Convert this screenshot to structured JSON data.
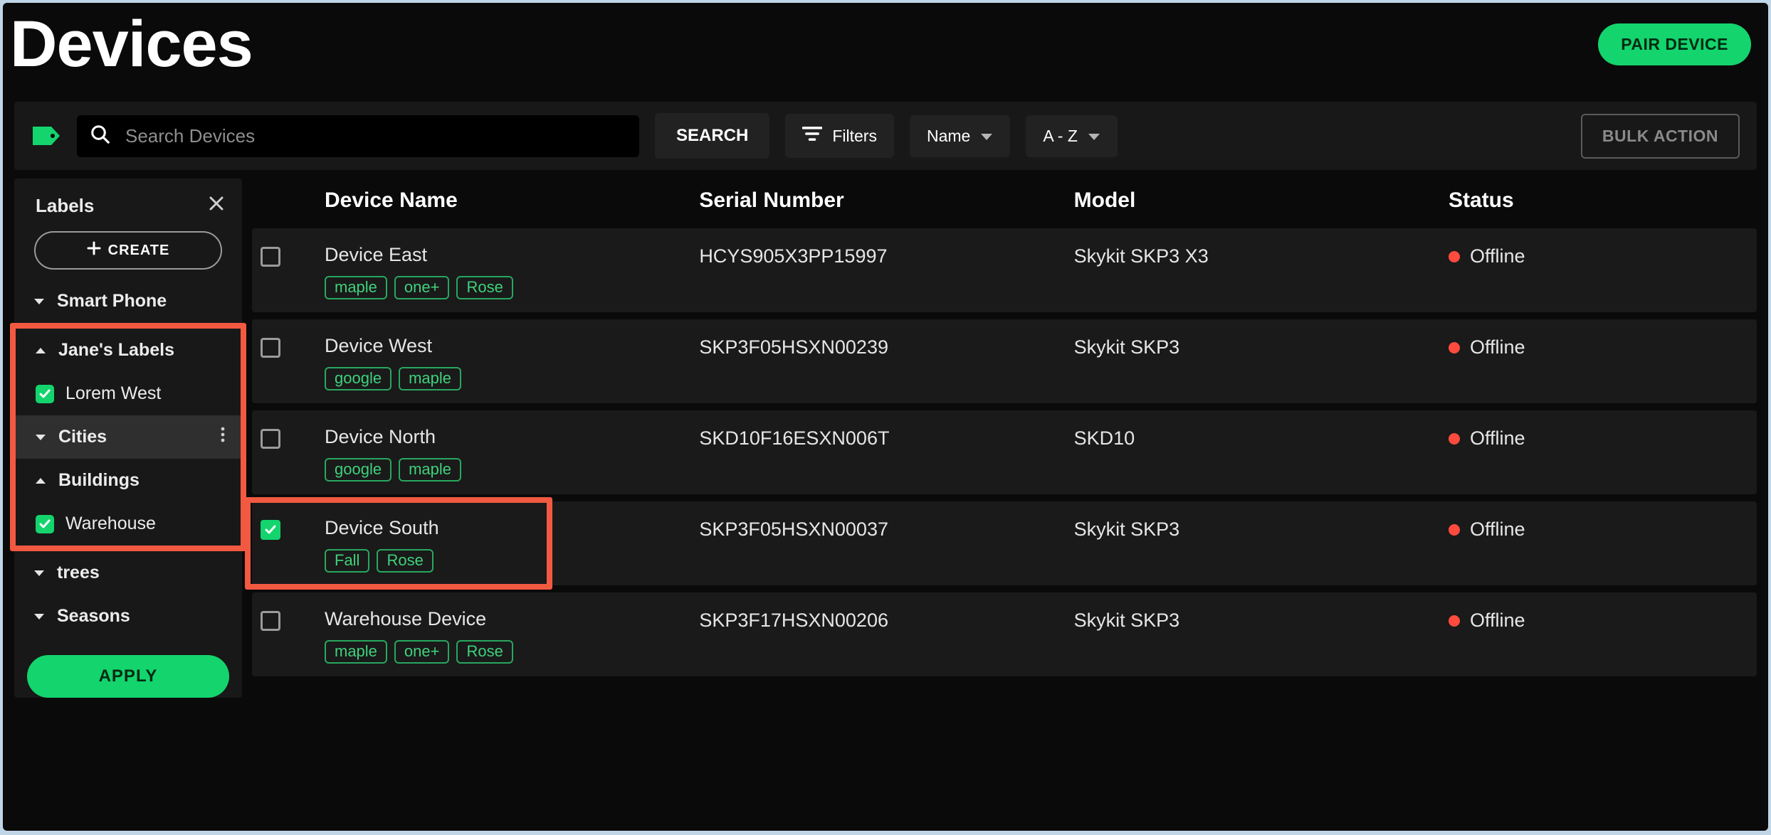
{
  "header": {
    "title": "Devices",
    "pair_button": "PAIR DEVICE"
  },
  "toolbar": {
    "search_placeholder": "Search Devices",
    "search_value": "",
    "search_button": "SEARCH",
    "filters_button": "Filters",
    "sort_field": "Name",
    "sort_order": "A - Z",
    "bulk_action": "BULK ACTION"
  },
  "sidebar": {
    "title": "Labels",
    "create_button": "CREATE",
    "apply_button": "APPLY",
    "groups": [
      {
        "name": "Smart Phone",
        "expanded": false
      },
      {
        "name": "Jane's Labels",
        "expanded": true,
        "items": [
          {
            "name": "Lorem West",
            "checked": true
          }
        ]
      },
      {
        "name": "Cities",
        "expanded": false,
        "has_menu": true,
        "highlighted_row": true
      },
      {
        "name": "Buildings",
        "expanded": true,
        "items": [
          {
            "name": "Warehouse",
            "checked": true
          }
        ]
      },
      {
        "name": "trees",
        "expanded": false
      },
      {
        "name": "Seasons",
        "expanded": false
      }
    ]
  },
  "table": {
    "columns": [
      "Device Name",
      "Serial Number",
      "Model",
      "Status"
    ],
    "rows": [
      {
        "selected": false,
        "name": "Device East",
        "serial": "HCYS905X3PP15997",
        "model": "Skykit SKP3 X3",
        "status": "Offline",
        "tags": [
          "maple",
          "one+",
          "Rose"
        ]
      },
      {
        "selected": false,
        "name": "Device West",
        "serial": "SKP3F05HSXN00239",
        "model": "Skykit SKP3",
        "status": "Offline",
        "tags": [
          "google",
          "maple"
        ]
      },
      {
        "selected": false,
        "name": "Device North",
        "serial": "SKD10F16ESXN006T",
        "model": "SKD10",
        "status": "Offline",
        "tags": [
          "google",
          "maple"
        ]
      },
      {
        "selected": true,
        "highlighted": true,
        "name": "Device South",
        "serial": "SKP3F05HSXN00037",
        "model": "Skykit SKP3",
        "status": "Offline",
        "tags": [
          "Fall",
          "Rose"
        ]
      },
      {
        "selected": false,
        "name": "Warehouse Device",
        "serial": "SKP3F17HSXN00206",
        "model": "Skykit SKP3",
        "status": "Offline",
        "tags": [
          "maple",
          "one+",
          "Rose"
        ]
      }
    ]
  }
}
